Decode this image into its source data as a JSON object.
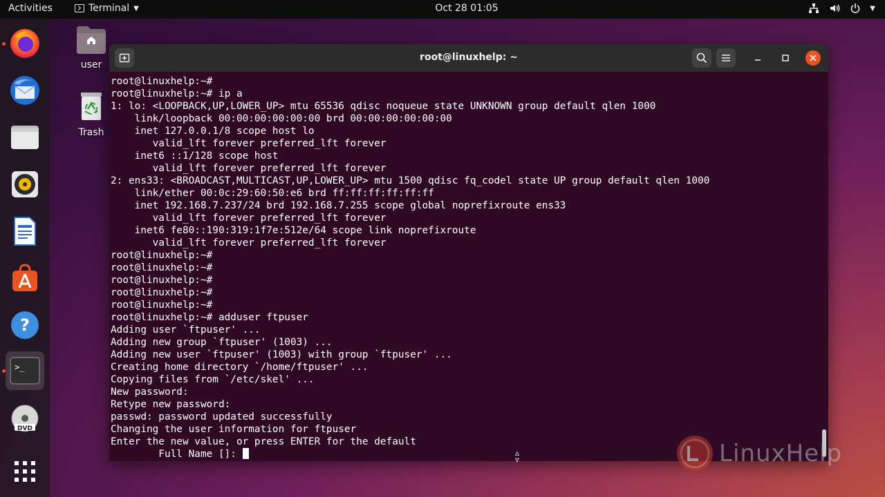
{
  "topbar": {
    "activities": "Activities",
    "app_name": "Terminal",
    "clock": "Oct 28  01:05",
    "tray_icons": [
      "network-icon",
      "volume-icon",
      "power-icon"
    ]
  },
  "dock": {
    "items": [
      {
        "name": "firefox",
        "running": true
      },
      {
        "name": "thunderbird",
        "running": false
      },
      {
        "name": "files",
        "running": false
      },
      {
        "name": "rhythmbox",
        "running": false
      },
      {
        "name": "libreoffice-writer",
        "running": false
      },
      {
        "name": "ubuntu-software",
        "running": false
      },
      {
        "name": "help",
        "running": false
      },
      {
        "name": "terminal",
        "running": true
      },
      {
        "name": "dvd",
        "running": false
      },
      {
        "name": "show-applications",
        "running": false
      }
    ]
  },
  "desktop": {
    "home_label": "user",
    "trash_label": "Trash"
  },
  "window": {
    "title": "root@linuxhelp: ~",
    "lines": [
      "root@linuxhelp:~#",
      "root@linuxhelp:~# ip a",
      "1: lo: <LOOPBACK,UP,LOWER_UP> mtu 65536 qdisc noqueue state UNKNOWN group default qlen 1000",
      "    link/loopback 00:00:00:00:00:00 brd 00:00:00:00:00:00",
      "    inet 127.0.0.1/8 scope host lo",
      "       valid_lft forever preferred_lft forever",
      "    inet6 ::1/128 scope host",
      "       valid_lft forever preferred_lft forever",
      "2: ens33: <BROADCAST,MULTICAST,UP,LOWER_UP> mtu 1500 qdisc fq_codel state UP group default qlen 1000",
      "    link/ether 00:0c:29:60:50:e6 brd ff:ff:ff:ff:ff:ff",
      "    inet 192.168.7.237/24 brd 192.168.7.255 scope global noprefixroute ens33",
      "       valid_lft forever preferred_lft forever",
      "    inet6 fe80::190:319:1f7e:512e/64 scope link noprefixroute",
      "       valid_lft forever preferred_lft forever",
      "root@linuxhelp:~#",
      "root@linuxhelp:~#",
      "root@linuxhelp:~#",
      "root@linuxhelp:~#",
      "root@linuxhelp:~#",
      "root@linuxhelp:~# adduser ftpuser",
      "Adding user `ftpuser' ...",
      "Adding new group `ftpuser' (1003) ...",
      "Adding new user `ftpuser' (1003) with group `ftpuser' ...",
      "Creating home directory `/home/ftpuser' ...",
      "Copying files from `/etc/skel' ...",
      "New password:",
      "Retype new password:",
      "passwd: password updated successfully",
      "Changing the user information for ftpuser",
      "Enter the new value, or press ENTER for the default"
    ],
    "prompt_line": "        Full Name []: "
  },
  "watermark": "LinuxHelp",
  "colors": {
    "terminal_bg": "#300a24",
    "accent": "#e95420"
  }
}
